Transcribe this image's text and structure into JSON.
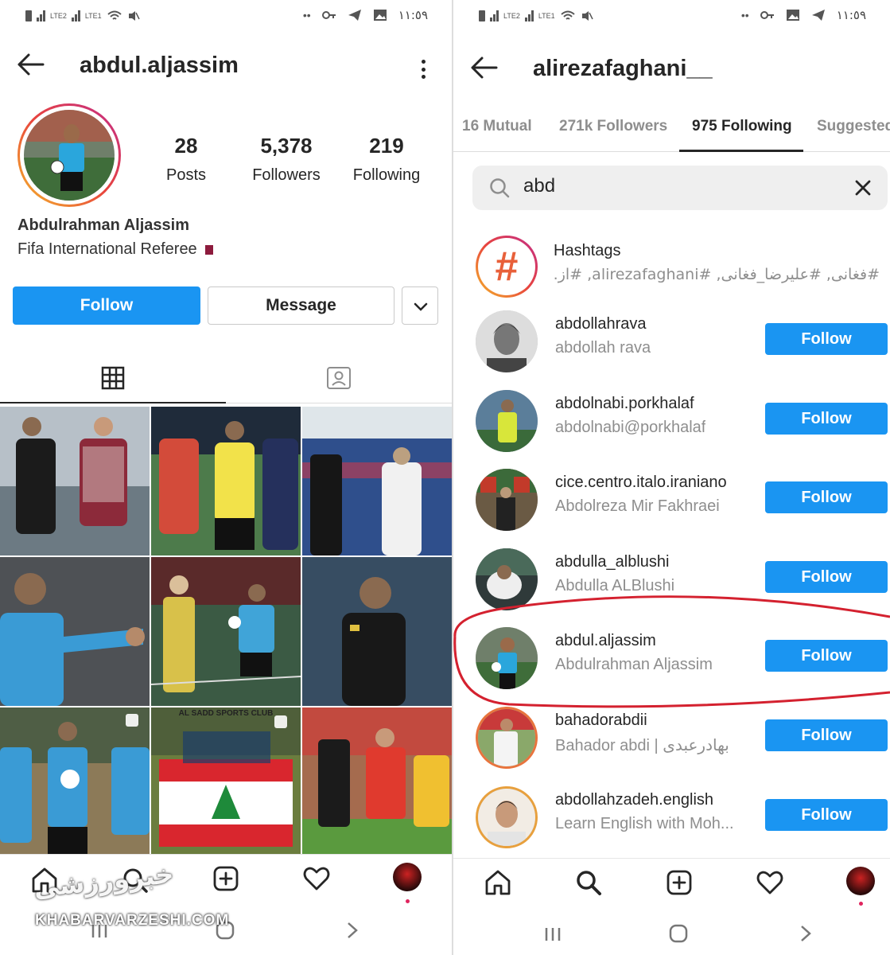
{
  "status": {
    "clock": "١١:٥٩",
    "lte1": "LTE2",
    "lte2": "LTE1",
    "volte": "Vo)"
  },
  "left": {
    "username": "abdul.aljassim",
    "stats": [
      {
        "number": "28",
        "label": "Posts"
      },
      {
        "number": "5,378",
        "label": "Followers"
      },
      {
        "number": "219",
        "label": "Following"
      }
    ],
    "bio_name": "Abdulrahman Aljassim",
    "bio_text": "Fifa International Referee",
    "follow_label": "Follow",
    "message_label": "Message",
    "grid_caption_1": "AL SADD SPORTS CLUB",
    "watermark_fa": "خبرورزشی",
    "watermark_en": "KHABARVARZESHI.COM"
  },
  "right": {
    "username": "alirezafaghani__",
    "tabs": [
      {
        "label": "16 Mutual"
      },
      {
        "label": "271k Followers"
      },
      {
        "label": "975 Following"
      },
      {
        "label": "Suggested"
      }
    ],
    "search_value": "abd",
    "hashtags": {
      "title": "Hashtags",
      "subtitle": "#فغانی, #علیرضا_فغانی, #alirezafaghani, #از..."
    },
    "results": [
      {
        "username": "abdollahrava",
        "fullname": "abdollah rava",
        "button": "Follow"
      },
      {
        "username": "abdolnabi.porkhalaf",
        "fullname": "abdolnabi@porkhalaf",
        "button": "Follow"
      },
      {
        "username": "cice.centro.italo.iraniano",
        "fullname": "Abdolreza Mir Fakhraei",
        "button": "Follow"
      },
      {
        "username": "abdulla_alblushi",
        "fullname": "Abdulla ALBlushi",
        "button": "Follow"
      },
      {
        "username": "abdul.aljassim",
        "fullname": "Abdulrahman Aljassim",
        "button": "Follow"
      },
      {
        "username": "bahadorabdii",
        "fullname": "Bahador abdi | بهادرعبدی",
        "button": "Follow"
      },
      {
        "username": "abdollahzadeh.english",
        "fullname": "Learn English with Moh...",
        "button": "Follow"
      }
    ]
  },
  "colors": {
    "accent_blue": "#1a95f2",
    "highlight_red": "#d4212f"
  }
}
